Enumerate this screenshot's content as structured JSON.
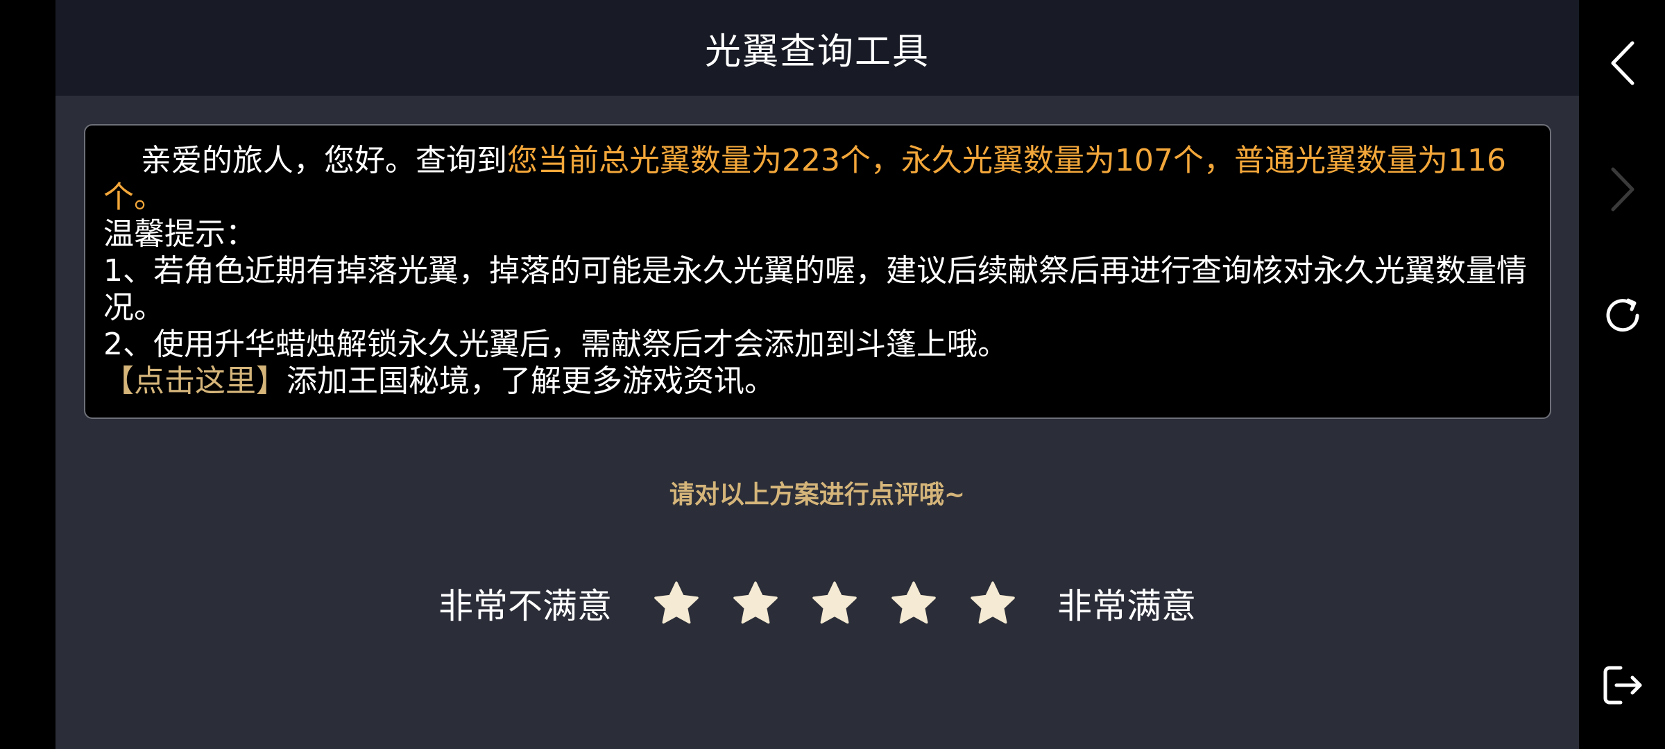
{
  "header": {
    "title": "光翼查询工具"
  },
  "message": {
    "greeting": "亲爱的旅人，您好。查询到",
    "highlight": "您当前总光翼数量为223个，永久光翼数量为107个，普通光翼数量为116个。",
    "tips_title": "温馨提示：",
    "tip1": "1、若角色近期有掉落光翼，掉落的可能是永久光翼的喔，建议后续献祭后再进行查询核对永久光翼数量情况。",
    "tip2": "2、使用升华蜡烛解锁永久光翼后，需献祭后才会添加到斗篷上哦。",
    "link_label": "【点击这里】",
    "link_suffix": "添加王国秘境，了解更多游戏资讯。"
  },
  "rating": {
    "prompt": "请对以上方案进行点评哦~",
    "low_label": "非常不满意",
    "high_label": "非常满意",
    "star_count": 5,
    "star_color": "#f5ead3"
  },
  "nav": {
    "icons": [
      "back-icon",
      "forward-icon",
      "refresh-icon",
      "exit-icon"
    ]
  },
  "colors": {
    "accent_orange": "#f3a73a",
    "accent_gold": "#d5b57a",
    "background": "#2b2e38",
    "header": "#181b25"
  }
}
